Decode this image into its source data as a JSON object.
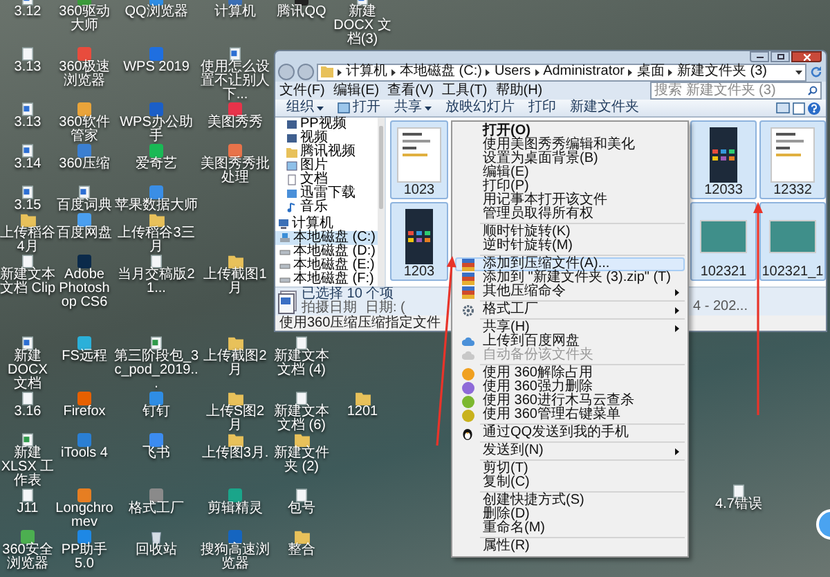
{
  "desktop_icons": [
    [
      {
        "label": "3.12",
        "kind": "word"
      },
      {
        "label": "360驱动大师",
        "kind": "app",
        "color": "#3a9b3a"
      },
      {
        "label": "QQ浏览器",
        "kind": "app",
        "color": "#2f8de4"
      },
      {
        "label": "计算机",
        "kind": "app",
        "color": "#3b6fb6"
      },
      {
        "label": "腾讯QQ",
        "kind": "app",
        "color": "#222222"
      },
      {
        "label": "新建DOCX 文档(3)",
        "kind": "word"
      }
    ],
    [
      {
        "label": "3.13",
        "kind": "text"
      },
      {
        "label": "360极速浏览器",
        "kind": "app",
        "color": "#e84c3d"
      },
      {
        "label": "WPS 2019",
        "kind": "app",
        "color": "#1f6fe0"
      },
      {
        "label": "使用怎么设置不让别人下...",
        "kind": "word"
      }
    ],
    [
      {
        "label": "3.13",
        "kind": "word"
      },
      {
        "label": "360软件管家",
        "kind": "app",
        "color": "#e9a43a"
      },
      {
        "label": "WPS办公助手",
        "kind": "app",
        "color": "#1b5fc8"
      },
      {
        "label": "美图秀秀",
        "kind": "app",
        "color": "#e8334a"
      }
    ],
    [
      {
        "label": "3.14",
        "kind": "word"
      },
      {
        "label": "360压缩",
        "kind": "app",
        "color": "#3b7fd1"
      },
      {
        "label": "爱奇艺",
        "kind": "app",
        "color": "#19b955"
      },
      {
        "label": "美图秀秀批处理",
        "kind": "app",
        "color": "#e8734a"
      }
    ],
    [
      {
        "label": "3.15",
        "kind": "word"
      },
      {
        "label": "百度词典",
        "kind": "word"
      },
      {
        "label": "苹果数据大师",
        "kind": "app",
        "color": "#3a8ee6"
      }
    ],
    [
      {
        "label": "上传稻谷4月",
        "kind": "folder"
      },
      {
        "label": "百度网盘",
        "kind": "app",
        "color": "#4a9ff0"
      },
      {
        "label": "上传稻谷3三月",
        "kind": "folder"
      }
    ],
    [
      {
        "label": "新建文本文档 Clip",
        "kind": "text"
      },
      {
        "label": "Adobe Photoshop CS6",
        "kind": "app",
        "color": "#0b2a4a"
      },
      {
        "label": "当月交稿版2 1...",
        "kind": "text"
      },
      {
        "label": "上传截图1月",
        "kind": "folder"
      }
    ],
    [
      {
        "label": "新建DOCX 文档",
        "kind": "word"
      },
      {
        "label": "FS远程",
        "kind": "app",
        "color": "#2bb0d9"
      },
      {
        "label": "第三阶段包_3 c_pod_2019...",
        "kind": "sheet"
      },
      {
        "label": "上传截图2月",
        "kind": "folder"
      },
      {
        "label": "新建文本文档 (4)",
        "kind": "text"
      }
    ],
    [
      {
        "label": "3.16",
        "kind": "text"
      },
      {
        "label": "Firefox",
        "kind": "app",
        "color": "#e66000"
      },
      {
        "label": "钉钉",
        "kind": "app",
        "color": "#2f8de4"
      },
      {
        "label": "上传S图2月",
        "kind": "folder"
      },
      {
        "label": "新建文本文档 (6)",
        "kind": "text"
      },
      {
        "label": "1201",
        "kind": "folder"
      }
    ],
    [
      {
        "label": "新建XLSX 工作表",
        "kind": "sheet"
      },
      {
        "label": "iTools 4",
        "kind": "app",
        "color": "#2a7fd4"
      },
      {
        "label": "飞书",
        "kind": "app",
        "color": "#3c8cf0"
      },
      {
        "label": "上传图3月.",
        "kind": "folder"
      },
      {
        "label": "新建文件夹 (2)",
        "kind": "folder"
      }
    ],
    [
      {
        "label": "J11",
        "kind": "text"
      },
      {
        "label": "Longchromev",
        "kind": "app",
        "color": "#e67e22"
      },
      {
        "label": "格式工厂",
        "kind": "app",
        "color": "#8a8a8a"
      },
      {
        "label": "剪辑精灵",
        "kind": "app",
        "color": "#1aa58a"
      },
      {
        "label": "包号",
        "kind": "text"
      }
    ],
    [
      {
        "label": "360安全浏览器",
        "kind": "app",
        "color": "#4caf50"
      },
      {
        "label": "PP助手5.0",
        "kind": "app",
        "color": "#1e88e5"
      },
      {
        "label": "回收站",
        "kind": "recycle"
      },
      {
        "label": "搜狗高速浏览器",
        "kind": "app",
        "color": "#1565c0"
      },
      {
        "label": "整合",
        "kind": "folder"
      }
    ]
  ],
  "corner_icon": {
    "label": "4.7错误",
    "kind": "text"
  },
  "explorer": {
    "address": [
      "计算机",
      "本地磁盘 (C:)",
      "Users",
      "Administrator",
      "桌面",
      "新建文件夹 (3)"
    ],
    "menu": [
      "文件(F)",
      "编辑(E)",
      "查看(V)",
      "工具(T)",
      "帮助(H)"
    ],
    "search": {
      "placeholder": "搜索 新建文件夹 (3)"
    },
    "toolbar": [
      {
        "label": "组织",
        "dropdown": true,
        "kind": "plain"
      },
      {
        "label": "打开",
        "dropdown": false,
        "kind": "image"
      },
      {
        "label": "共享",
        "dropdown": true,
        "kind": "plain"
      },
      {
        "label": "放映幻灯片",
        "dropdown": false,
        "kind": "plain"
      },
      {
        "label": "打印",
        "dropdown": false,
        "kind": "plain"
      },
      {
        "label": "新建文件夹",
        "dropdown": false,
        "kind": "plain"
      }
    ],
    "sidebar": {
      "libraries": [
        {
          "label": "PP视频",
          "kind": "video",
          "selected": false
        },
        {
          "label": "视频",
          "kind": "video",
          "selected": false
        },
        {
          "label": "腾讯视频",
          "kind": "folder",
          "selected": false
        },
        {
          "label": "图片",
          "kind": "picture",
          "selected": false
        },
        {
          "label": "文档",
          "kind": "document",
          "selected": false
        },
        {
          "label": "迅雷下载",
          "kind": "download",
          "selected": false
        },
        {
          "label": "音乐",
          "kind": "music",
          "selected": false
        }
      ],
      "computer": {
        "label": "计算机",
        "selected": false,
        "children": [
          {
            "label": "本地磁盘 (C:)",
            "kind": "system",
            "selected": true
          },
          {
            "label": "本地磁盘 (D:)",
            "kind": "drive",
            "selected": false
          },
          {
            "label": "本地磁盘 (E:)",
            "kind": "drive",
            "selected": false
          },
          {
            "label": "本地磁盘 (F:)",
            "kind": "drive",
            "selected": false
          }
        ]
      }
    },
    "thumbnail_rows": [
      [
        {
          "label": "1023",
          "kind": "document",
          "selected": true
        },
        {
          "label": "12033",
          "kind": "phone",
          "selected": true
        },
        {
          "label": "12332",
          "kind": "document",
          "selected": true
        }
      ],
      [
        {
          "label": "1203",
          "kind": "phone",
          "selected": true
        },
        {
          "label": "102321",
          "kind": "photo",
          "selected": true
        },
        {
          "label": "102321_1",
          "kind": "photo",
          "selected": true
        }
      ]
    ],
    "details": {
      "selection": "已选择 10 个项",
      "fields": [
        "拍摄日期",
        "日期: ("
      ],
      "right_text": "4 - 202..."
    },
    "status_bar": "使用360压缩压缩指定文件"
  },
  "context_menu": [
    {
      "kind": "plain",
      "label": "打开(O)",
      "default": true,
      "selected": false,
      "disabled": false,
      "submenu": false
    },
    {
      "kind": "plain",
      "label": "使用美图秀秀编辑和美化",
      "default": false,
      "selected": false,
      "disabled": false,
      "submenu": false
    },
    {
      "kind": "plain",
      "label": "设置为桌面背景(B)",
      "default": false,
      "selected": false,
      "disabled": false,
      "submenu": false
    },
    {
      "kind": "plain",
      "label": "编辑(E)",
      "default": false,
      "selected": false,
      "disabled": false,
      "submenu": false
    },
    {
      "kind": "plain",
      "label": "打印(P)",
      "default": false,
      "selected": false,
      "disabled": false,
      "submenu": false
    },
    {
      "kind": "plain",
      "label": "用记事本打开该文件",
      "default": false,
      "selected": false,
      "disabled": false,
      "submenu": false
    },
    {
      "kind": "plain",
      "label": "管理员取得所有权",
      "default": false,
      "selected": false,
      "disabled": false,
      "submenu": false
    },
    {
      "kind": "separator"
    },
    {
      "kind": "plain",
      "label": "顺时针旋转(K)",
      "default": false,
      "selected": false,
      "disabled": false,
      "submenu": false
    },
    {
      "kind": "plain",
      "label": "逆时针旋转(M)",
      "default": false,
      "selected": false,
      "disabled": false,
      "submenu": false
    },
    {
      "kind": "separator"
    },
    {
      "kind": "archive",
      "label": "添加到压缩文件(A)...",
      "default": false,
      "selected": true,
      "disabled": false,
      "submenu": false
    },
    {
      "kind": "archive",
      "label": "添加到 \"新建文件夹 (3).zip\" (T)",
      "default": false,
      "selected": false,
      "disabled": false,
      "submenu": false
    },
    {
      "kind": "archive",
      "label": "其他压缩命令",
      "default": false,
      "selected": false,
      "disabled": false,
      "submenu": true
    },
    {
      "kind": "separator"
    },
    {
      "kind": "gear",
      "label": "格式工厂",
      "default": false,
      "selected": false,
      "disabled": false,
      "submenu": true
    },
    {
      "kind": "separator"
    },
    {
      "kind": "plain",
      "label": "共享(H)",
      "default": false,
      "selected": false,
      "disabled": false,
      "submenu": true
    },
    {
      "kind": "cloud",
      "label": "上传到百度网盘",
      "default": false,
      "selected": false,
      "disabled": false,
      "submenu": false
    },
    {
      "kind": "cloud",
      "label": "自动备份该文件夹",
      "default": false,
      "selected": false,
      "disabled": true,
      "submenu": false
    },
    {
      "kind": "separator"
    },
    {
      "kind": "shield",
      "color": "#f0a020",
      "label": "使用 360解除占用",
      "default": false,
      "selected": false,
      "disabled": false,
      "submenu": false
    },
    {
      "kind": "shield",
      "color": "#8e6ad8",
      "label": "使用 360强力删除",
      "default": false,
      "selected": false,
      "disabled": false,
      "submenu": false
    },
    {
      "kind": "shield",
      "color": "#7cb82f",
      "label": "使用 360进行木马云查杀",
      "default": false,
      "selected": false,
      "disabled": false,
      "submenu": false
    },
    {
      "kind": "shield",
      "color": "#c9b21c",
      "label": "使用 360管理右键菜单",
      "default": false,
      "selected": false,
      "disabled": false,
      "submenu": false
    },
    {
      "kind": "separator"
    },
    {
      "kind": "penguin",
      "label": "通过QQ发送到我的手机",
      "default": false,
      "selected": false,
      "disabled": false,
      "submenu": false
    },
    {
      "kind": "separator"
    },
    {
      "kind": "plain",
      "label": "发送到(N)",
      "default": false,
      "selected": false,
      "disabled": false,
      "submenu": true
    },
    {
      "kind": "separator"
    },
    {
      "kind": "plain",
      "label": "剪切(T)",
      "default": false,
      "selected": false,
      "disabled": false,
      "submenu": false
    },
    {
      "kind": "plain",
      "label": "复制(C)",
      "default": false,
      "selected": false,
      "disabled": false,
      "submenu": false
    },
    {
      "kind": "separator"
    },
    {
      "kind": "plain",
      "label": "创建快捷方式(S)",
      "default": false,
      "selected": false,
      "disabled": false,
      "submenu": false
    },
    {
      "kind": "plain",
      "label": "删除(D)",
      "default": false,
      "selected": false,
      "disabled": false,
      "submenu": false
    },
    {
      "kind": "plain",
      "label": "重命名(M)",
      "default": false,
      "selected": false,
      "disabled": false,
      "submenu": false
    },
    {
      "kind": "separator"
    },
    {
      "kind": "plain",
      "label": "属性(R)",
      "default": false,
      "selected": false,
      "disabled": false,
      "submenu": false
    }
  ]
}
